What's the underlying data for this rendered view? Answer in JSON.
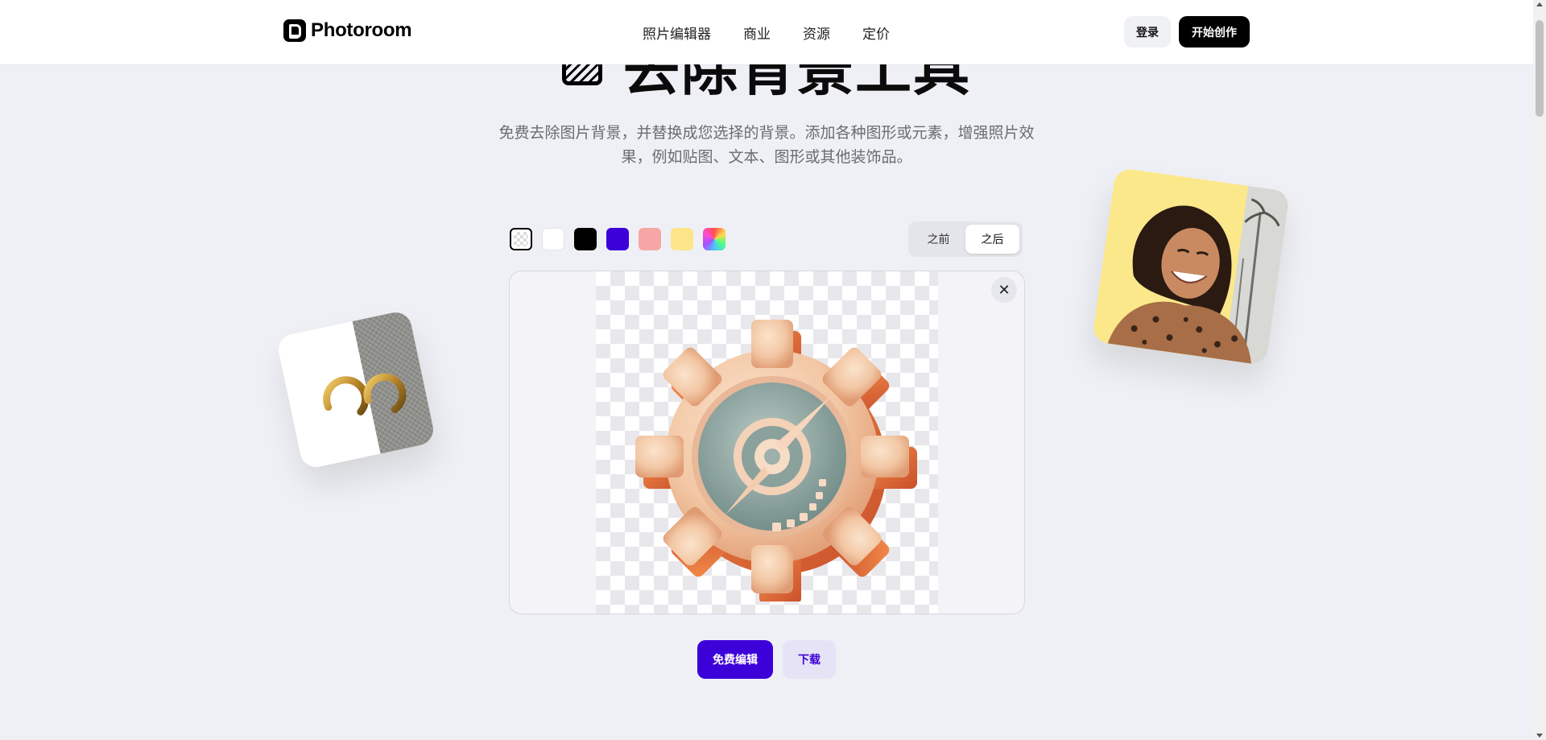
{
  "header": {
    "brand": "Photoroom",
    "nav": [
      "照片编辑器",
      "商业",
      "资源",
      "定价"
    ],
    "login_label": "登录",
    "start_label": "开始创作"
  },
  "hero": {
    "title": "去除背景工具",
    "subtitle_line1": "免费去除图片背景，并替换成您选择的背景。添加各种图形或元素，增强照片效",
    "subtitle_line2": "果，例如贴图、文本、图形或其他装饰品。"
  },
  "editor": {
    "swatches": [
      {
        "name": "transparent",
        "selected": true
      },
      {
        "name": "white",
        "color": "#ffffff"
      },
      {
        "name": "black",
        "color": "#000000"
      },
      {
        "name": "purple",
        "color": "#3c00d9"
      },
      {
        "name": "pink",
        "color": "#f7a6a6"
      },
      {
        "name": "yellow",
        "color": "#fde58a"
      },
      {
        "name": "rainbow"
      }
    ],
    "toggle": {
      "before": "之前",
      "after": "之后",
      "active": "after"
    },
    "close_icon": "close-icon",
    "image_subject": "gear-compass-icon"
  },
  "actions": {
    "edit_label": "免费编辑",
    "download_label": "下载"
  },
  "colors": {
    "accent": "#3c00d9",
    "background": "#eff0f5"
  }
}
